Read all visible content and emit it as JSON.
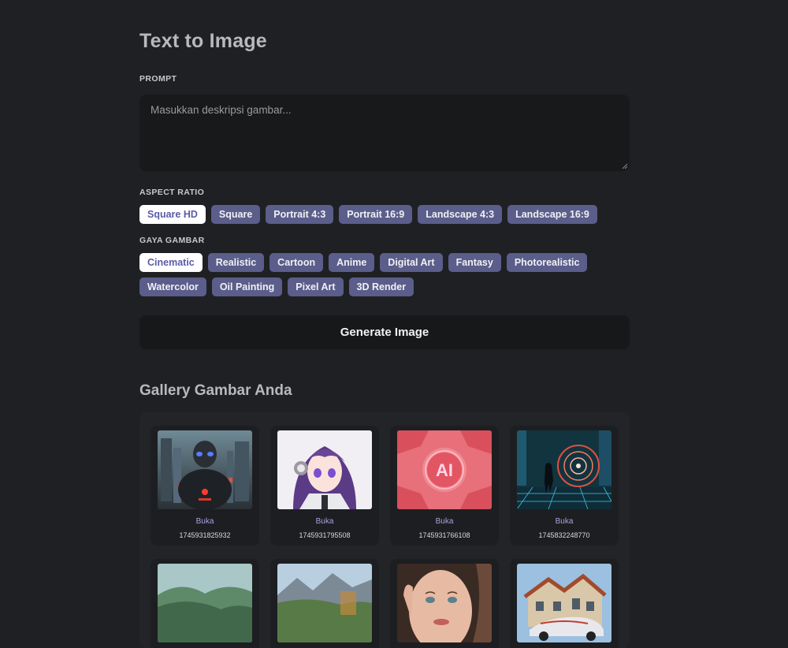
{
  "page": {
    "title": "Text to Image"
  },
  "prompt": {
    "label": "PROMPT",
    "placeholder": "Masukkan deskripsi gambar...",
    "value": ""
  },
  "aspect_ratio": {
    "label": "ASPECT RATIO",
    "selected": "Square HD",
    "options": [
      "Square HD",
      "Square",
      "Portrait 4:3",
      "Portrait 16:9",
      "Landscape 4:3",
      "Landscape 16:9"
    ]
  },
  "style": {
    "label": "GAYA GAMBAR",
    "selected": "Cinematic",
    "options": [
      "Cinematic",
      "Realistic",
      "Cartoon",
      "Anime",
      "Digital Art",
      "Fantasy",
      "Photorealistic",
      "Watercolor",
      "Oil Painting",
      "Pixel Art",
      "3D Render"
    ]
  },
  "generate_button": {
    "label": "Generate Image"
  },
  "gallery": {
    "title": "Gallery Gambar Anda",
    "items": [
      {
        "open_label": "Buka",
        "id": "1745931825932",
        "thumb": "robot"
      },
      {
        "open_label": "Buka",
        "id": "1745931795508",
        "thumb": "anime"
      },
      {
        "open_label": "Buka",
        "id": "1745931766108",
        "thumb": "ai"
      },
      {
        "open_label": "Buka",
        "id": "1745832248770",
        "thumb": "portal"
      },
      {
        "open_label": "",
        "id": "",
        "thumb": "hills"
      },
      {
        "open_label": "",
        "id": "",
        "thumb": "lake"
      },
      {
        "open_label": "",
        "id": "",
        "thumb": "woman"
      },
      {
        "open_label": "",
        "id": "",
        "thumb": "mansion"
      }
    ]
  },
  "colors": {
    "background": "#1f2023",
    "chip": "#5b5d8a",
    "chip_active": "#ffffff",
    "link": "#a6a2e0"
  }
}
